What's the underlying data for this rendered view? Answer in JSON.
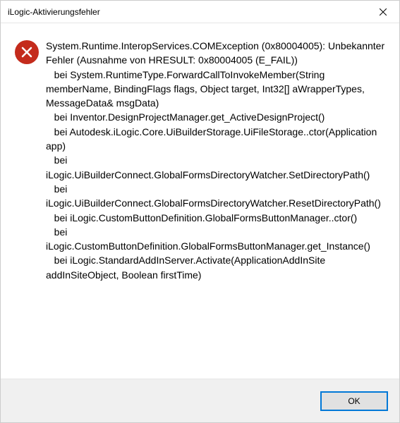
{
  "titlebar": {
    "title": "iLogic-Aktivierungsfehler"
  },
  "message": "System.Runtime.InteropServices.COMException (0x80004005): Unbekannter Fehler (Ausnahme von HRESULT: 0x80004005 (E_FAIL))\n   bei System.RuntimeType.ForwardCallToInvokeMember(String memberName, BindingFlags flags, Object target, Int32[] aWrapperTypes, MessageData& msgData)\n   bei Inventor.DesignProjectManager.get_ActiveDesignProject()\n   bei Autodesk.iLogic.Core.UiBuilderStorage.UiFileStorage..ctor(Application app)\n   bei iLogic.UiBuilderConnect.GlobalFormsDirectoryWatcher.SetDirectoryPath()\n   bei iLogic.UiBuilderConnect.GlobalFormsDirectoryWatcher.ResetDirectoryPath()\n   bei iLogic.CustomButtonDefinition.GlobalFormsButtonManager..ctor()\n   bei iLogic.CustomButtonDefinition.GlobalFormsButtonManager.get_Instance()\n   bei iLogic.StandardAddInServer.Activate(ApplicationAddInSite addInSiteObject, Boolean firstTime)",
  "buttons": {
    "ok": "OK"
  }
}
